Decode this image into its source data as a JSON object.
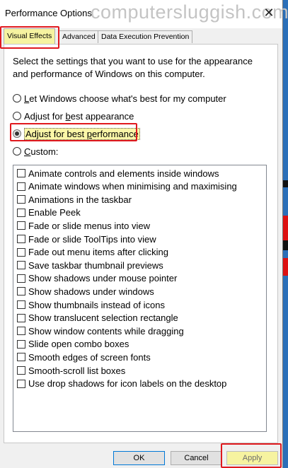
{
  "window": {
    "title": "Performance Options",
    "watermark": "computersluggish.com",
    "close_glyph": "✕"
  },
  "tabs": [
    {
      "label": "Visual Effects",
      "active": true
    },
    {
      "label": "Advanced",
      "active": false
    },
    {
      "label": "Data Execution Prevention",
      "active": false
    }
  ],
  "description": "Select the settings that you want to use for the appearance and performance of Windows on this computer.",
  "options": [
    {
      "first": "L",
      "rest": "et Windows choose what's best for my computer",
      "checked": false
    },
    {
      "pre": "Adjust for ",
      "first": "b",
      "rest": "est appearance",
      "checked": false
    },
    {
      "pre": "Adjust for best ",
      "first": "p",
      "rest": "erformance",
      "checked": true
    },
    {
      "first": "C",
      "rest": "ustom:",
      "checked": false
    }
  ],
  "effects": [
    "Animate controls and elements inside windows",
    "Animate windows when minimising and maximising",
    "Animations in the taskbar",
    "Enable Peek",
    "Fade or slide menus into view",
    "Fade or slide ToolTips into view",
    "Fade out menu items after clicking",
    "Save taskbar thumbnail previews",
    "Show shadows under mouse pointer",
    "Show shadows under windows",
    "Show thumbnails instead of icons",
    "Show translucent selection rectangle",
    "Show window contents while dragging",
    "Slide open combo boxes",
    "Smooth edges of screen fonts",
    "Smooth-scroll list boxes",
    "Use drop shadows for icon labels on the desktop"
  ],
  "buttons": {
    "ok": "OK",
    "cancel": "Cancel",
    "apply": "Apply"
  },
  "colors": {
    "highlight_red": "#e0191e",
    "selected_yellow": "#f6f3a0"
  }
}
